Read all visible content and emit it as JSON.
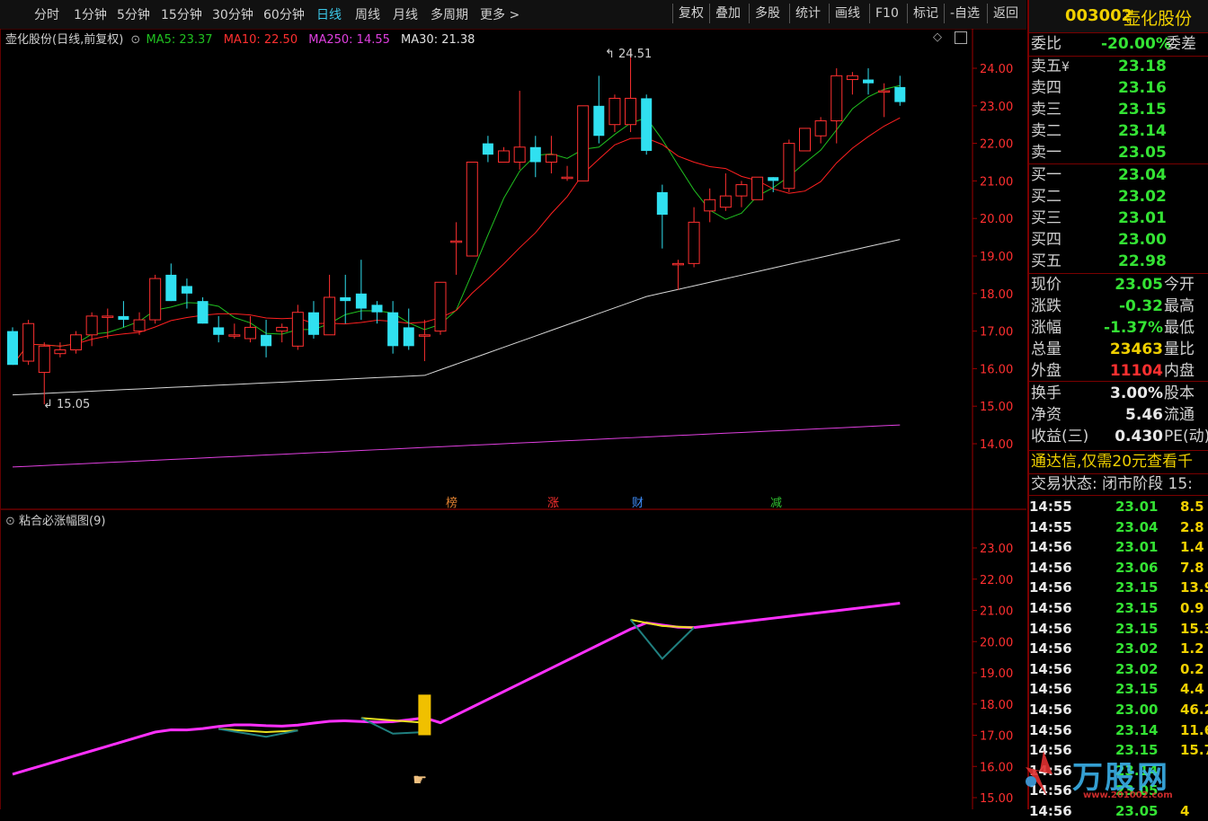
{
  "toolbar": {
    "periods": [
      "分时",
      "1分钟",
      "5分钟",
      "15分钟",
      "30分钟",
      "60分钟",
      "日线",
      "周线",
      "月线",
      "多周期",
      "更多 >"
    ],
    "active_period": "日线",
    "buttons": [
      "复权",
      "叠加",
      "多股",
      "统计",
      "画线",
      "F10",
      "标记",
      "-自选",
      "返回"
    ]
  },
  "main_chart": {
    "title": "壶化股份(日线,前复权)",
    "ma_labels": [
      {
        "text": "MA5: 23.37",
        "color": "#20c020"
      },
      {
        "text": "MA10: 22.50",
        "color": "#ff3030"
      },
      {
        "text": "MA250: 14.55",
        "color": "#e040e0"
      },
      {
        "text": "MA30: 21.38",
        "color": "#e0e0e0"
      }
    ],
    "y_ticks": [
      "24.00",
      "23.00",
      "22.00",
      "21.00",
      "20.00",
      "19.00",
      "18.00",
      "17.00",
      "16.00",
      "15.00",
      "14.00"
    ],
    "high_label": "24.51",
    "low_label": "15.05",
    "events": [
      {
        "text": "榜",
        "color": "#e08030"
      },
      {
        "text": "涨",
        "color": "#ff3030"
      },
      {
        "text": "财",
        "color": "#4090ff"
      },
      {
        "text": "减",
        "color": "#30c030"
      }
    ]
  },
  "indicator": {
    "title": "粘合必涨幅图(9)",
    "y_ticks": [
      "23.00",
      "22.00",
      "21.00",
      "20.00",
      "19.00",
      "18.00",
      "17.00",
      "16.00",
      "15.00"
    ]
  },
  "chart_data": {
    "type": "candlestick",
    "ohlc": [
      [
        17.0,
        16.1,
        17.1,
        16.3
      ],
      [
        16.2,
        17.2,
        16.1,
        17.3
      ],
      [
        15.9,
        16.6,
        15.05,
        16.7
      ],
      [
        16.4,
        16.5,
        16.3,
        16.7
      ],
      [
        16.5,
        16.9,
        16.4,
        17.0
      ],
      [
        16.9,
        17.4,
        16.6,
        17.5
      ],
      [
        17.4,
        17.4,
        16.8,
        17.6
      ],
      [
        17.4,
        17.3,
        17.1,
        17.8
      ],
      [
        17.0,
        17.3,
        16.9,
        17.5
      ],
      [
        17.3,
        18.4,
        17.2,
        18.5
      ],
      [
        18.5,
        17.8,
        17.8,
        18.8
      ],
      [
        18.2,
        18.0,
        17.6,
        18.4
      ],
      [
        17.8,
        17.2,
        17.2,
        17.9
      ],
      [
        17.1,
        16.9,
        16.7,
        17.4
      ],
      [
        16.9,
        16.9,
        16.8,
        17.2
      ],
      [
        16.8,
        17.1,
        16.7,
        17.4
      ],
      [
        16.9,
        16.6,
        16.3,
        17.3
      ],
      [
        17.0,
        17.1,
        16.7,
        17.2
      ],
      [
        16.6,
        17.5,
        16.5,
        17.7
      ],
      [
        17.5,
        16.9,
        16.8,
        17.8
      ],
      [
        16.9,
        17.9,
        16.9,
        18.5
      ],
      [
        17.9,
        17.8,
        17.2,
        18.5
      ],
      [
        18.0,
        17.6,
        17.3,
        18.9
      ],
      [
        17.7,
        17.5,
        17.2,
        17.8
      ],
      [
        17.5,
        16.6,
        16.4,
        17.8
      ],
      [
        17.1,
        16.6,
        16.5,
        17.6
      ],
      [
        16.9,
        16.9,
        16.2,
        17.3
      ],
      [
        17.0,
        18.3,
        16.9,
        18.3
      ],
      [
        19.4,
        19.4,
        18.5,
        19.9
      ],
      [
        19.0,
        21.5,
        19.0,
        21.5
      ],
      [
        22.0,
        21.7,
        21.5,
        22.2
      ],
      [
        21.5,
        21.8,
        21.5,
        21.9
      ],
      [
        21.5,
        21.9,
        21.3,
        23.4
      ],
      [
        21.9,
        21.5,
        21.1,
        22.2
      ],
      [
        21.5,
        21.7,
        21.2,
        22.2
      ],
      [
        21.1,
        21.1,
        21.0,
        21.4
      ],
      [
        21.0,
        23.0,
        21.0,
        23.0
      ],
      [
        23.0,
        22.2,
        22.0,
        23.8
      ],
      [
        22.5,
        23.2,
        22.3,
        23.3
      ],
      [
        22.5,
        23.2,
        22.3,
        24.51
      ],
      [
        23.2,
        21.8,
        21.7,
        23.3
      ],
      [
        20.7,
        20.1,
        19.2,
        20.9
      ],
      [
        18.8,
        18.8,
        18.1,
        18.9
      ],
      [
        18.8,
        19.9,
        18.7,
        20.3
      ],
      [
        20.2,
        20.5,
        19.9,
        20.8
      ],
      [
        20.3,
        20.6,
        20.2,
        21.2
      ],
      [
        20.6,
        20.9,
        20.3,
        21.0
      ],
      [
        20.5,
        21.1,
        20.5,
        21.1
      ],
      [
        21.1,
        21.0,
        20.7,
        21.1
      ],
      [
        20.8,
        22.0,
        20.7,
        22.1
      ],
      [
        21.8,
        22.4,
        21.8,
        22.4
      ],
      [
        22.2,
        22.6,
        22.0,
        22.7
      ],
      [
        22.6,
        23.8,
        22.0,
        24.0
      ],
      [
        23.7,
        23.8,
        23.3,
        23.9
      ],
      [
        23.7,
        23.6,
        23.3,
        24.0
      ],
      [
        23.4,
        23.4,
        22.7,
        23.6
      ],
      [
        23.5,
        23.1,
        23.0,
        23.8
      ]
    ],
    "ylim": [
      13.5,
      24.9
    ]
  },
  "quote": {
    "code": "003002",
    "name": "壶化股份",
    "weibi_label": "委比",
    "weibi_value": "-20.00%",
    "weicha_label": "委差",
    "sells": [
      {
        "label": "卖五",
        "value": "23.18"
      },
      {
        "label": "卖四",
        "value": "23.16"
      },
      {
        "label": "卖三",
        "value": "23.15"
      },
      {
        "label": "卖二",
        "value": "23.14"
      },
      {
        "label": "卖一",
        "value": "23.05"
      }
    ],
    "sell5_mark": "¥",
    "buys": [
      {
        "label": "买一",
        "value": "23.04"
      },
      {
        "label": "买二",
        "value": "23.02"
      },
      {
        "label": "买三",
        "value": "23.01"
      },
      {
        "label": "买四",
        "value": "23.00"
      },
      {
        "label": "买五",
        "value": "22.98"
      }
    ],
    "stats": [
      {
        "label": "现价",
        "value": "23.05",
        "color": "#34e234",
        "label2": "今开"
      },
      {
        "label": "涨跌",
        "value": "-0.32",
        "color": "#34e234",
        "label2": "最高"
      },
      {
        "label": "涨幅",
        "value": "-1.37%",
        "color": "#34e234",
        "label2": "最低"
      },
      {
        "label": "总量",
        "value": "23463",
        "color": "#f0d000",
        "label2": "量比"
      },
      {
        "label": "外盘",
        "value": "11104",
        "color": "#ff3030",
        "label2": "内盘"
      }
    ],
    "stats2": [
      {
        "label": "换手",
        "value": "3.00%",
        "label2": "股本"
      },
      {
        "label": "净资",
        "value": "5.46",
        "label2": "流通"
      },
      {
        "label": "收益(三)",
        "value": "0.430",
        "label2": "PE(动)"
      }
    ],
    "promo": "通达信,仅需20元查看千",
    "status": "交易状态: 闭市阶段 15:",
    "ticks": [
      {
        "time": "14:55",
        "price": "23.01",
        "vol": "8.5",
        "color": "#34e234"
      },
      {
        "time": "14:55",
        "price": "23.04",
        "vol": "2.8",
        "color": "#34e234"
      },
      {
        "time": "14:56",
        "price": "23.01",
        "vol": "1.4",
        "color": "#34e234"
      },
      {
        "time": "14:56",
        "price": "23.06",
        "vol": "7.8",
        "color": "#34e234"
      },
      {
        "time": "14:56",
        "price": "23.15",
        "vol": "13.9",
        "color": "#34e234"
      },
      {
        "time": "14:56",
        "price": "23.15",
        "vol": "0.9",
        "color": "#34e234"
      },
      {
        "time": "14:56",
        "price": "23.15",
        "vol": "15.3",
        "color": "#34e234"
      },
      {
        "time": "14:56",
        "price": "23.02",
        "vol": "1.2",
        "color": "#34e234"
      },
      {
        "time": "14:56",
        "price": "23.02",
        "vol": "0.2",
        "color": "#34e234"
      },
      {
        "time": "14:56",
        "price": "23.15",
        "vol": "4.4",
        "color": "#34e234"
      },
      {
        "time": "14:56",
        "price": "23.00",
        "vol": "46.2",
        "color": "#34e234"
      },
      {
        "time": "14:56",
        "price": "23.14",
        "vol": "11.6",
        "color": "#34e234"
      },
      {
        "time": "14:56",
        "price": "23.15",
        "vol": "15.7",
        "color": "#34e234"
      },
      {
        "time": "14:56",
        "price": "23.14",
        "vol": "",
        "color": "#34e234"
      },
      {
        "time": "14:56",
        "price": "23.05",
        "vol": "",
        "color": "#34e234"
      },
      {
        "time": "14:56",
        "price": "23.05",
        "vol": "4",
        "color": "#34e234"
      }
    ],
    "watermark": "万股网",
    "watermark_url": "www.201002.com"
  }
}
